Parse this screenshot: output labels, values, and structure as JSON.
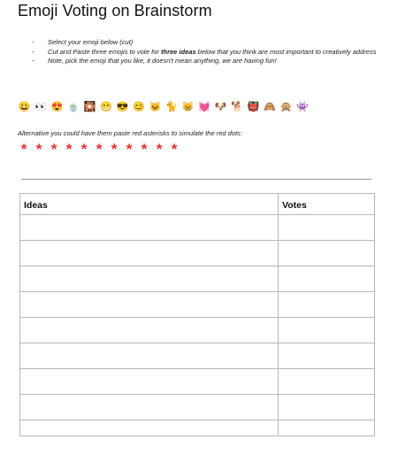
{
  "document": {
    "title": "Emoji Voting on Brainstorm",
    "instructions": [
      {
        "text": "Select your emoji below (cut)"
      },
      {
        "pre": "Cut and Paste three emojis to vote for ",
        "bold": "three ideas",
        "post": "  below that you think are most important to creatively address"
      },
      {
        "text": "Note, pick the emoji that you like, it doesn't mean anything, we are having fun!"
      }
    ],
    "emojis": [
      "😀",
      "👀",
      "😍",
      "🍵",
      "🎇",
      "😁",
      "😎",
      "😊",
      "🐱",
      "🐈",
      "😸",
      "💓",
      "🐶",
      "🐕",
      "👹",
      "🙈",
      "🙊",
      "👾"
    ],
    "alternative_text": "Alternative you could have them paste red asterisks to simulate the red dots:",
    "asterisks": [
      "*",
      "*",
      "*",
      "*",
      "*",
      "*",
      "*",
      "*",
      "*",
      "*",
      "*"
    ],
    "asterisk_color": "#ea2f2f",
    "table": {
      "headers": [
        "Ideas",
        "Votes"
      ],
      "row_count": 9
    }
  }
}
